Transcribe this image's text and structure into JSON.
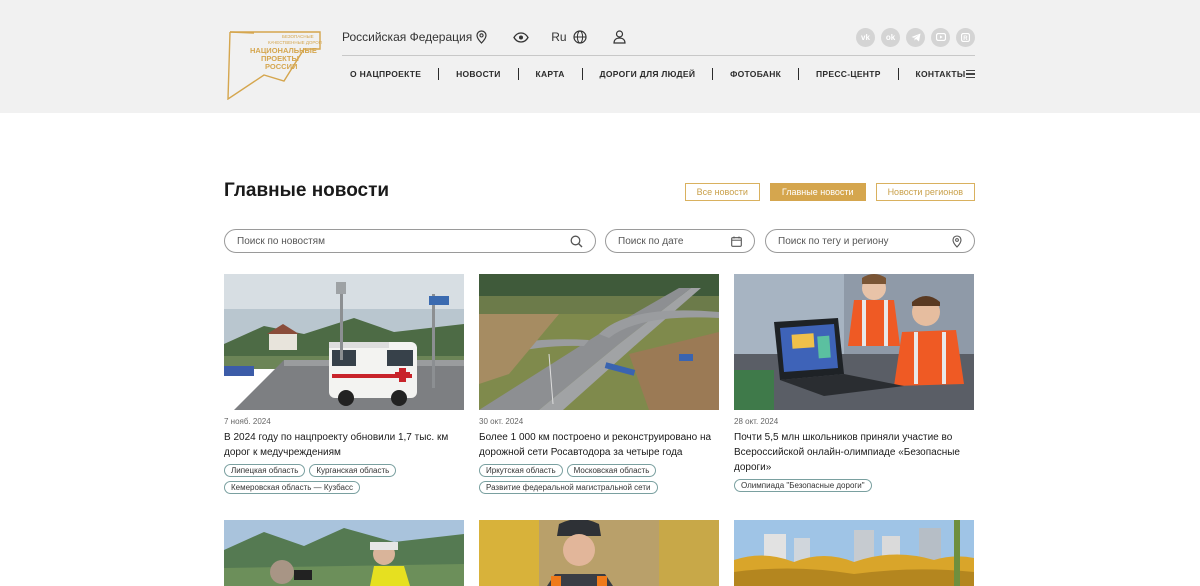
{
  "header": {
    "logo_text": "БЕЗОПАСНЫЕ КАЧЕСТВЕННЫЕ ДОРОГИ НАЦИОНАЛЬНЫЕ ПРОЕКТЫ РОССИИ",
    "region": "Российская Федерация",
    "language": "Ru",
    "social": [
      "vk",
      "ok",
      "telegram",
      "youtube",
      "rutube"
    ],
    "nav": [
      "О НАЦПРОЕКТЕ",
      "НОВОСТИ",
      "КАРТА",
      "ДОРОГИ ДЛЯ ЛЮДЕЙ",
      "ФОТОБАНК",
      "ПРЕСС-ЦЕНТР",
      "КОНТАКТЫ"
    ]
  },
  "main": {
    "title": "Главные новости",
    "filters": [
      "Все новости",
      "Главные новости",
      "Новости регионов"
    ],
    "active_filter": "Главные новости",
    "search": {
      "news_placeholder": "Поиск по новостям",
      "date_placeholder": "Поиск по дате",
      "tag_placeholder": "Поиск по тегу и региону"
    },
    "cards": [
      {
        "date": "7 нояб. 2024",
        "title": "В 2024 году по нацпроекту обновили 1,7 тыс. км дорог к медучреждениям",
        "tags": [
          "Липецкая область",
          "Курганская область",
          "Кемеровская область — Кузбасс"
        ]
      },
      {
        "date": "30 окт. 2024",
        "title": "Более 1 000 км построено и реконструировано на дорожной сети Росавтодора за четыре года",
        "tags": [
          "Иркутская область",
          "Московская область",
          "Развитие федеральной магистральной сети"
        ]
      },
      {
        "date": "28 окт. 2024",
        "title": "Почти 5,5 млн школьников приняли участие во Всероссийской онлайн-олимпиаде «Безопасные дороги»",
        "tags": [
          "Олимпиада \"Безопасные дороги\""
        ]
      }
    ]
  },
  "colors": {
    "accent": "#d5a64e",
    "header_bg": "#f1f1f1",
    "tag_border": "#7aa0a0"
  }
}
